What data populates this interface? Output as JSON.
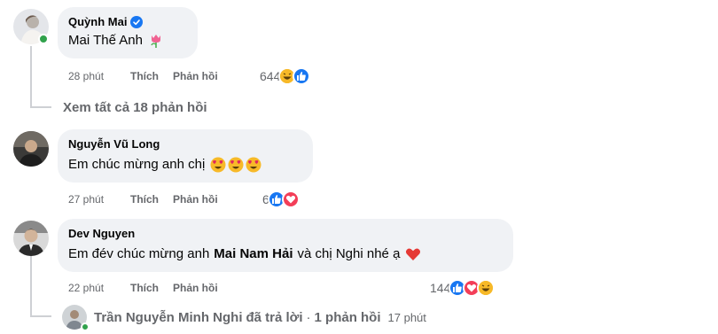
{
  "comments": [
    {
      "author": "Quỳnh Mai",
      "verified": true,
      "online": true,
      "text": "Mai Thế Anh",
      "text_emoji": "tulip-icon",
      "time": "28 phút",
      "like_label": "Thích",
      "reply_label": "Phản hồi",
      "reaction_count": "644",
      "reactions": [
        "haha",
        "like"
      ]
    },
    {
      "author": "Nguyễn Vũ Long",
      "online": false,
      "text": "Em chúc mừng anh chị",
      "text_emoji": "heart-eyes-icon x3",
      "time": "27 phút",
      "like_label": "Thích",
      "reply_label": "Phản hồi",
      "reaction_count": "6",
      "reactions": [
        "like",
        "love"
      ]
    },
    {
      "author": "Dev Nguyen",
      "online": false,
      "text_before": "Em đév chúc mừng anh",
      "text_tag": "Mai Nam Hải",
      "text_after": "và chị Nghi nhé ạ",
      "text_emoji": "red-heart-icon",
      "time": "22 phút",
      "like_label": "Thích",
      "reply_label": "Phản hồi",
      "reaction_count": "144",
      "reactions": [
        "like",
        "love",
        "haha"
      ]
    }
  ],
  "view_more_replies": "Xem tất cả 18 phản hồi",
  "reply_summary": {
    "name": "Trần Nguyễn Minh Nghi",
    "action": "đã trả lời",
    "separator": "·",
    "count": "1 phản hồi",
    "time": "17 phút"
  },
  "colors": {
    "bubble": "#f0f2f5",
    "meta_text": "#65676b",
    "like_blue": "#1877f2",
    "love_red": "#f33e58",
    "online_green": "#31a24c"
  }
}
